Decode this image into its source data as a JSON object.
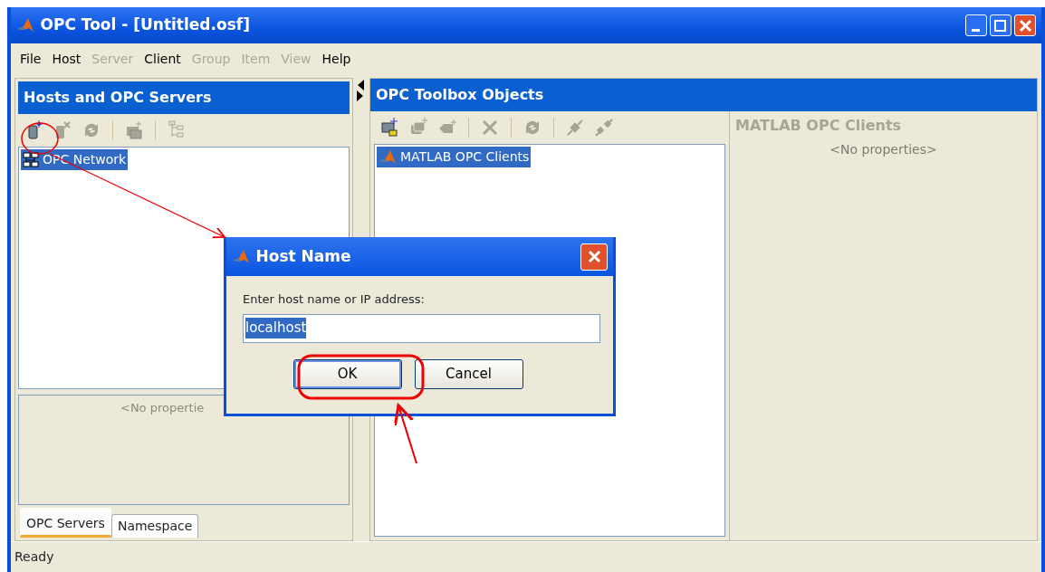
{
  "window": {
    "title": "OPC Tool - [Untitled.osf]"
  },
  "menu": [
    {
      "label": "File",
      "disabled": false
    },
    {
      "label": "Host",
      "disabled": false
    },
    {
      "label": "Server",
      "disabled": true
    },
    {
      "label": "Client",
      "disabled": false
    },
    {
      "label": "Group",
      "disabled": true
    },
    {
      "label": "Item",
      "disabled": true
    },
    {
      "label": "View",
      "disabled": true
    },
    {
      "label": "Help",
      "disabled": false
    }
  ],
  "hosts_panel": {
    "title": "Hosts and OPC Servers",
    "toolbar": [
      {
        "kind": "new-host",
        "disabled": false
      },
      {
        "kind": "delete-host",
        "disabled": true
      },
      {
        "kind": "refresh",
        "disabled": true
      },
      {
        "kind": "separator"
      },
      {
        "kind": "add-server",
        "disabled": true
      },
      {
        "kind": "separator"
      },
      {
        "kind": "tree",
        "disabled": true
      }
    ],
    "tree": [
      {
        "label": "OPC Network",
        "selected": true
      }
    ],
    "properties": "<No propertie",
    "tabs": [
      {
        "label": "OPC Servers",
        "selected": true
      },
      {
        "label": "Namespace",
        "selected": false
      }
    ]
  },
  "objects_panel": {
    "title": "OPC Toolbox Objects",
    "toolbar": [
      {
        "kind": "new-client",
        "disabled": false
      },
      {
        "kind": "add-group",
        "disabled": true
      },
      {
        "kind": "add-item",
        "disabled": true
      },
      {
        "kind": "separator"
      },
      {
        "kind": "delete",
        "disabled": true
      },
      {
        "kind": "separator"
      },
      {
        "kind": "refresh",
        "disabled": true
      },
      {
        "kind": "separator"
      },
      {
        "kind": "connect",
        "disabled": true
      },
      {
        "kind": "disconnect",
        "disabled": true
      }
    ],
    "tree": [
      {
        "label": "MATLAB OPC Clients",
        "selected": true
      }
    ],
    "properties": {
      "title": "MATLAB OPC Clients",
      "text": "<No properties>"
    }
  },
  "status_bar": "Ready",
  "dialog": {
    "title": "Host Name",
    "prompt": "Enter host name or IP address:",
    "value": "localhost",
    "text_selected": true,
    "buttons": [
      {
        "label": "OK",
        "default": true
      },
      {
        "label": "Cancel",
        "default": false
      }
    ]
  }
}
